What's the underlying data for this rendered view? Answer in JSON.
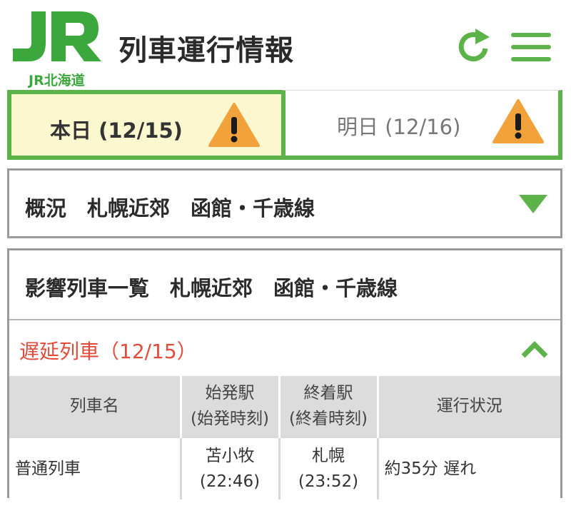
{
  "header": {
    "logo_mark": "JR",
    "logo_sub": "JR北海道",
    "title": "列車運行情報"
  },
  "icons": {
    "refresh": "refresh-icon",
    "menu": "hamburger-menu-icon",
    "warning": "warning-icon"
  },
  "colors": {
    "brand_green": "#5db34a",
    "active_tab_bg": "#fbf8cf",
    "warning_orange": "#f2a23a",
    "delay_red": "#e24a3a"
  },
  "tabs": [
    {
      "label": "本日 (12/15)",
      "active": true
    },
    {
      "label": "明日 (12/16)",
      "active": false
    }
  ],
  "overview": {
    "title": "概況　札幌近郊　函館・千歳線"
  },
  "affected": {
    "title": "影響列車一覧　札幌近郊　函館・千歳線",
    "section_title": "遅延列車（12/15）",
    "columns": [
      {
        "line1": "列車名",
        "line2": ""
      },
      {
        "line1": "始発駅",
        "line2": "(始発時刻)"
      },
      {
        "line1": "終着駅",
        "line2": "(終着時刻)"
      },
      {
        "line1": "運行状況",
        "line2": ""
      }
    ],
    "rows": [
      {
        "train": "普通列車",
        "origin": "苫小牧",
        "origin_time": "(22:46)",
        "destination": "札幌",
        "destination_time": "(23:52)",
        "status": "約35分 遅れ"
      }
    ]
  }
}
